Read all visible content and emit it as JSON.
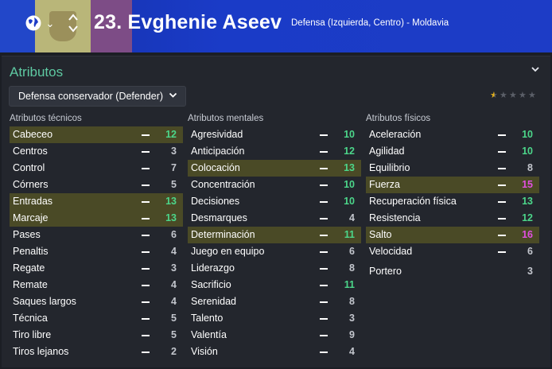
{
  "header": {
    "number_name": "23. Evghenie Aseev",
    "subtitle": "Defensa (Izquierda, Centro) - Moldavia",
    "colors": {
      "bg": "#1a3bc7",
      "flag_blue": "#2247c9",
      "flag_yellow": "#b9b679",
      "flag_red": "#7d4c86"
    }
  },
  "panel": {
    "title": "Atributos",
    "role_select": "Defensa conservador (Defender)",
    "rating_stars": 0.5,
    "rating_max": 5
  },
  "columns": [
    {
      "heading": "Atributos técnicos",
      "rows": [
        {
          "name": "Cabeceo",
          "value": "12",
          "tone": "green",
          "highlight": true
        },
        {
          "name": "Centros",
          "value": "3",
          "tone": "grey",
          "highlight": false
        },
        {
          "name": "Control",
          "value": "7",
          "tone": "grey",
          "highlight": false
        },
        {
          "name": "Córners",
          "value": "5",
          "tone": "grey",
          "highlight": false
        },
        {
          "name": "Entradas",
          "value": "13",
          "tone": "green",
          "highlight": true
        },
        {
          "name": "Marcaje",
          "value": "13",
          "tone": "green",
          "highlight": true
        },
        {
          "name": "Pases",
          "value": "6",
          "tone": "grey",
          "highlight": false
        },
        {
          "name": "Penaltis",
          "value": "4",
          "tone": "grey",
          "highlight": false
        },
        {
          "name": "Regate",
          "value": "3",
          "tone": "grey",
          "highlight": false
        },
        {
          "name": "Remate",
          "value": "4",
          "tone": "grey",
          "highlight": false
        },
        {
          "name": "Saques largos",
          "value": "4",
          "tone": "grey",
          "highlight": false
        },
        {
          "name": "Técnica",
          "value": "5",
          "tone": "grey",
          "highlight": false
        },
        {
          "name": "Tiro libre",
          "value": "5",
          "tone": "grey",
          "highlight": false
        },
        {
          "name": "Tiros lejanos",
          "value": "2",
          "tone": "grey",
          "highlight": false
        }
      ]
    },
    {
      "heading": "Atributos mentales",
      "rows": [
        {
          "name": "Agresividad",
          "value": "10",
          "tone": "green",
          "highlight": false
        },
        {
          "name": "Anticipación",
          "value": "12",
          "tone": "green",
          "highlight": false
        },
        {
          "name": "Colocación",
          "value": "13",
          "tone": "green",
          "highlight": true
        },
        {
          "name": "Concentración",
          "value": "10",
          "tone": "green",
          "highlight": false
        },
        {
          "name": "Decisiones",
          "value": "10",
          "tone": "green",
          "highlight": false
        },
        {
          "name": "Desmarques",
          "value": "4",
          "tone": "grey",
          "highlight": false
        },
        {
          "name": "Determinación",
          "value": "11",
          "tone": "green",
          "highlight": true
        },
        {
          "name": "Juego en equipo",
          "value": "6",
          "tone": "grey",
          "highlight": false
        },
        {
          "name": "Liderazgo",
          "value": "8",
          "tone": "grey",
          "highlight": false
        },
        {
          "name": "Sacrificio",
          "value": "11",
          "tone": "green",
          "highlight": false
        },
        {
          "name": "Serenidad",
          "value": "8",
          "tone": "grey",
          "highlight": false
        },
        {
          "name": "Talento",
          "value": "3",
          "tone": "grey",
          "highlight": false
        },
        {
          "name": "Valentía",
          "value": "9",
          "tone": "grey",
          "highlight": false
        },
        {
          "name": "Visión",
          "value": "4",
          "tone": "grey",
          "highlight": false
        }
      ]
    },
    {
      "heading": "Atributos físicos",
      "rows": [
        {
          "name": "Aceleración",
          "value": "10",
          "tone": "green",
          "highlight": false
        },
        {
          "name": "Agilidad",
          "value": "10",
          "tone": "green",
          "highlight": false
        },
        {
          "name": "Equilibrio",
          "value": "8",
          "tone": "grey",
          "highlight": false
        },
        {
          "name": "Fuerza",
          "value": "15",
          "tone": "pink",
          "highlight": true
        },
        {
          "name": "Recuperación física",
          "value": "13",
          "tone": "green",
          "highlight": false
        },
        {
          "name": "Resistencia",
          "value": "12",
          "tone": "green",
          "highlight": false
        },
        {
          "name": "Salto",
          "value": "16",
          "tone": "pink",
          "highlight": true
        },
        {
          "name": "Velocidad",
          "value": "6",
          "tone": "grey",
          "highlight": false
        }
      ],
      "extra": {
        "name": "Portero",
        "value": "3",
        "tone": "grey"
      }
    }
  ]
}
